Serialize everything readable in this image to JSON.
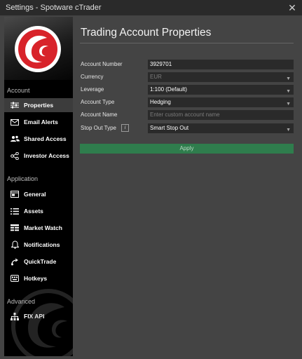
{
  "window": {
    "title": "Settings - Spotware cTrader"
  },
  "sidebar": {
    "sections": [
      {
        "label": "Account",
        "items": [
          {
            "label": "Properties",
            "icon": "sliders-icon",
            "active": true
          },
          {
            "label": "Email Alerts",
            "icon": "envelope-icon"
          },
          {
            "label": "Shared Access",
            "icon": "users-icon"
          },
          {
            "label": "Investor Access",
            "icon": "share-icon"
          }
        ]
      },
      {
        "label": "Application",
        "items": [
          {
            "label": "General",
            "icon": "window-icon"
          },
          {
            "label": "Assets",
            "icon": "list-icon"
          },
          {
            "label": "Market Watch",
            "icon": "table-icon"
          },
          {
            "label": "Notifications",
            "icon": "bell-icon"
          },
          {
            "label": "QuickTrade",
            "icon": "quicktrade-icon"
          },
          {
            "label": "Hotkeys",
            "icon": "keyboard-icon"
          }
        ]
      },
      {
        "label": "Advanced",
        "items": [
          {
            "label": "FIX API",
            "icon": "network-icon"
          }
        ]
      }
    ]
  },
  "main": {
    "title": "Trading Account Properties",
    "fields": {
      "account_number": {
        "label": "Account Number",
        "value": "3929701"
      },
      "currency": {
        "label": "Currency",
        "value": "EUR"
      },
      "leverage": {
        "label": "Leverage",
        "value": "1:100 (Default)"
      },
      "account_type": {
        "label": "Account Type",
        "value": "Hedging"
      },
      "account_name": {
        "label": "Account Name",
        "value": "",
        "placeholder": "Enter custom account name"
      },
      "stop_out_type": {
        "label": "Stop Out Type",
        "value": "Smart Stop Out",
        "info": "i"
      }
    },
    "apply_label": "Apply"
  },
  "colors": {
    "apply": "#2f7d4d",
    "logo_red": "#d8232a",
    "sidebar_bg": "#000000",
    "panel_bg": "#444444"
  }
}
